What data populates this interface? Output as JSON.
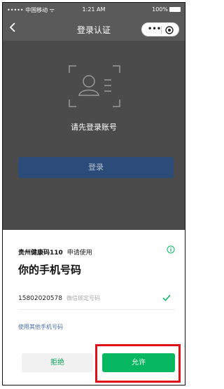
{
  "status_bar": {
    "carrier": "••••• 中国移动 ᯤ",
    "time": "1:21 AM",
    "battery": "100%"
  },
  "navbar": {
    "back_icon": "chevron-left-icon",
    "title": "登录认证",
    "more_icon": "more-dots-icon",
    "close_icon": "target-close-icon"
  },
  "login": {
    "illustration_icon": "user-id-card-icon",
    "prompt": "请先登录账号",
    "button_label": "登录"
  },
  "auth_sheet": {
    "app_name": "贵州健康码110",
    "request_text": "申请使用",
    "info_icon": "info-icon",
    "title": "你的手机号码",
    "phone_number": "15802020578",
    "phone_tag": "微信绑定号码",
    "check_icon": "check-icon",
    "other_link": "使用其他手机号码",
    "reject_label": "拒绝",
    "allow_label": "允许"
  },
  "colors": {
    "allow_green": "#07b860",
    "reject_text_green": "#07a658",
    "login_blue": "#2b4b78",
    "highlight_red": "#e0101b"
  }
}
